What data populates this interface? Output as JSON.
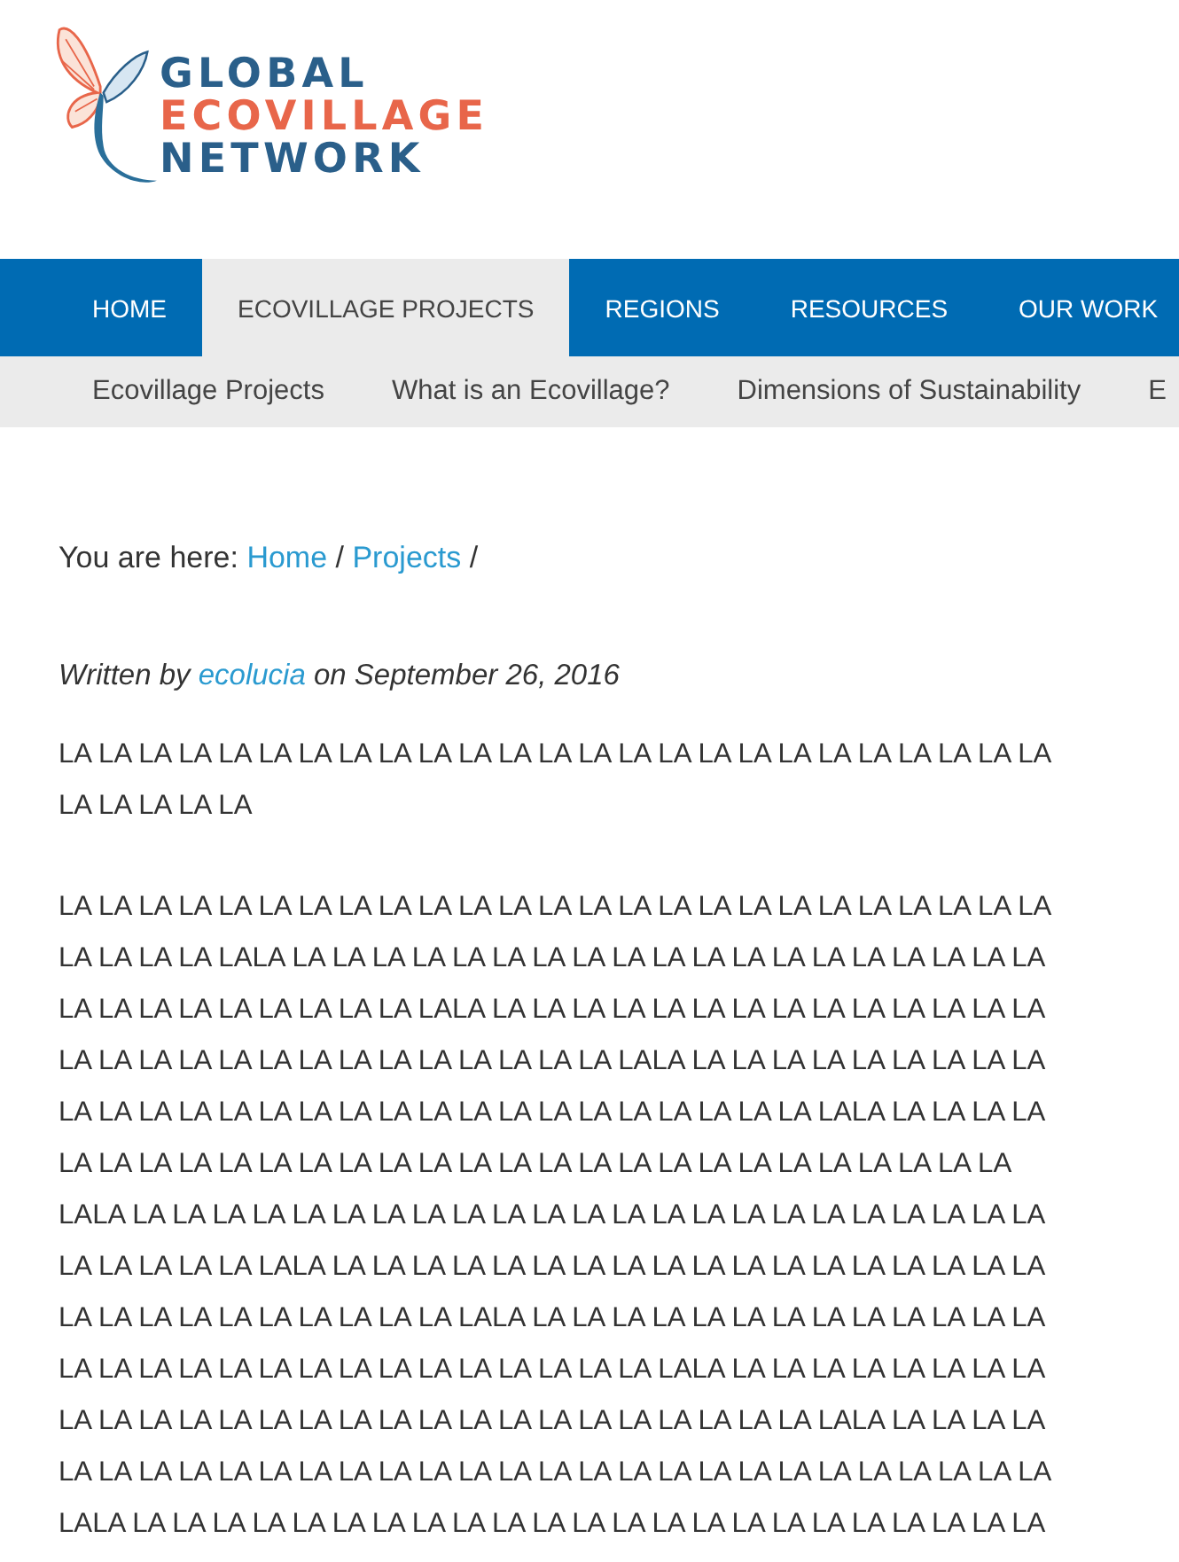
{
  "logo": {
    "lines": [
      {
        "text": "GLOBAL",
        "color": "#2a5f8a"
      },
      {
        "text": "ECOVILLAGE",
        "color": "#e8664a"
      },
      {
        "text": "NETWORK",
        "color": "#2a5f8a"
      }
    ]
  },
  "nav": [
    {
      "label": "HOME",
      "selected": false
    },
    {
      "label": "ECOVILLAGE PROJECTS",
      "selected": true
    },
    {
      "label": "REGIONS",
      "selected": false
    },
    {
      "label": "RESOURCES",
      "selected": false
    },
    {
      "label": "OUR WORK",
      "selected": false
    }
  ],
  "subnav": [
    "Ecovillage Projects",
    "What is an Ecovillage?",
    "Dimensions of Sustainability",
    "E"
  ],
  "breadcrumb": {
    "prefix": "You are here:",
    "links": [
      "Home",
      "Projects"
    ],
    "separator": "/"
  },
  "byline": {
    "before": "Written by",
    "author": "ecolucia",
    "after": "on September 26, 2016"
  },
  "paragraphs": [
    {
      "lines": [
        "LA LA LA LA LA LA LA LA LA LA LA LA LA LA LA LA LA LA LA LA LA LA LA LA LA",
        "LA LA LA LA LA"
      ]
    },
    {
      "lines": [
        "LA LA LA LA LA LA LA LA LA LA LA LA LA LA LA LA LA LA LA LA LA LA LA LA LA",
        "LA LA LA LA LALA LA LA LA LA LA LA LA LA LA LA LA LA LA LA LA LA LA LA LA",
        "LA LA LA LA LA LA LA LA LA LALA LA LA LA LA LA LA LA LA LA LA LA LA LA LA",
        "LA LA LA LA LA LA LA LA LA LA LA LA LA LA LALA LA LA LA LA LA LA LA LA LA",
        "LA LA LA LA LA LA LA LA LA LA LA LA LA LA LA LA LA LA LA LALA LA LA LA LA",
        "LA LA LA LA LA LA LA LA LA LA LA LA LA LA LA LA LA LA LA LA LA LA LA LA",
        "LALA LA LA LA LA LA LA LA LA LA LA LA LA LA LA LA LA LA LA LA LA LA LA LA",
        "LA LA LA LA LA LALA LA LA LA LA LA LA LA LA LA LA LA LA LA LA LA LA LA LA",
        "LA LA LA LA LA LA LA LA LA LA LALA LA LA LA LA LA LA LA LA LA LA LA LA LA",
        "LA LA LA LA LA LA LA LA LA LA LA LA LA LA LA LALA LA LA LA LA LA LA LA LA",
        "LA LA LA LA LA LA LA LA LA LA LA LA LA LA LA LA LA LA LA LALA LA LA LA LA",
        "LA LA LA LA LA LA LA LA LA LA LA LA LA LA LA LA LA LA LA LA LA LA LA LA LA",
        "LALA LA LA LA LA LA LA LA LA LA LA LA LA LA LA LA LA LA LA LA LA LA LA LA"
      ]
    }
  ]
}
